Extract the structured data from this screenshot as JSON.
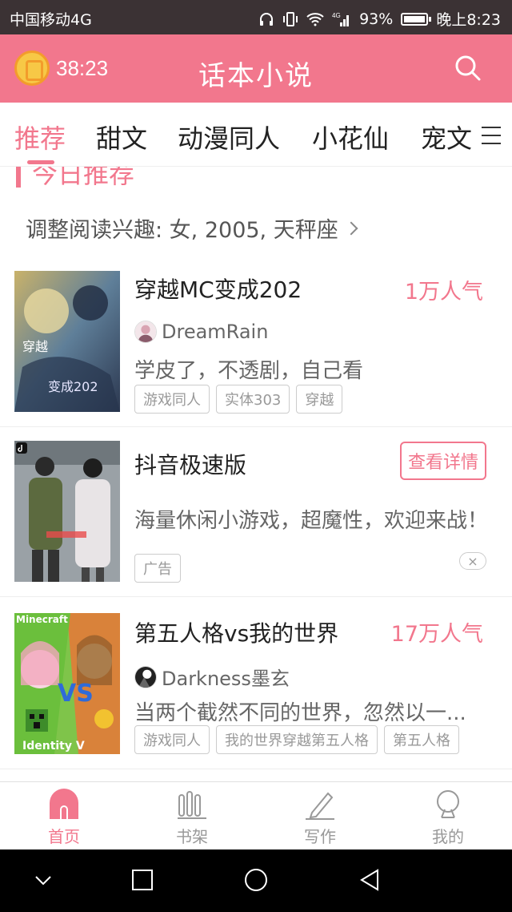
{
  "status_bar": {
    "carrier": "中国移动4G",
    "network": "4G",
    "battery": "93%",
    "time": "晚上8:23"
  },
  "header": {
    "timer": "38:23",
    "title": "话本小说"
  },
  "tabs": [
    {
      "label": "推荐",
      "active": true
    },
    {
      "label": "甜文",
      "active": false
    },
    {
      "label": "动漫同人",
      "active": false
    },
    {
      "label": "小花仙",
      "active": false
    },
    {
      "label": "宠文",
      "active": false
    }
  ],
  "section": {
    "title": "今日推荐",
    "interest_text": "调整阅读兴趣: 女, 2005, 天秤座"
  },
  "items": [
    {
      "title": "穿越MC变成202",
      "popularity": "1万人气",
      "author": "DreamRain",
      "description": "学皮了，不透剧，自己看",
      "tags": [
        "游戏同人",
        "实体303",
        "穿越"
      ],
      "cover_text": [
        "穿越",
        "变成202"
      ]
    },
    {
      "title": "抖音极速版",
      "button": "查看详情",
      "description": "海量休闲小游戏，超魔性，欢迎来战！",
      "tags": [
        "广告"
      ],
      "close": "×"
    },
    {
      "title": "第五人格vs我的世界",
      "popularity": "17万人气",
      "author": "Darkness墨玄",
      "description": "当两个截然不同的世界，忽然以一...",
      "tags": [
        "游戏同人",
        "我的世界穿越第五人格",
        "第五人格"
      ],
      "cover_text": [
        "Minecraft",
        "VS",
        "Identity V"
      ]
    }
  ],
  "bottom_nav": [
    {
      "label": "首页",
      "icon": "home-icon",
      "active": true
    },
    {
      "label": "书架",
      "icon": "bookshelf-icon",
      "active": false
    },
    {
      "label": "写作",
      "icon": "pen-icon",
      "active": false
    },
    {
      "label": "我的",
      "icon": "profile-icon",
      "active": false
    }
  ],
  "colors": {
    "accent": "#f2778d",
    "status_bar": "#3b3234"
  }
}
